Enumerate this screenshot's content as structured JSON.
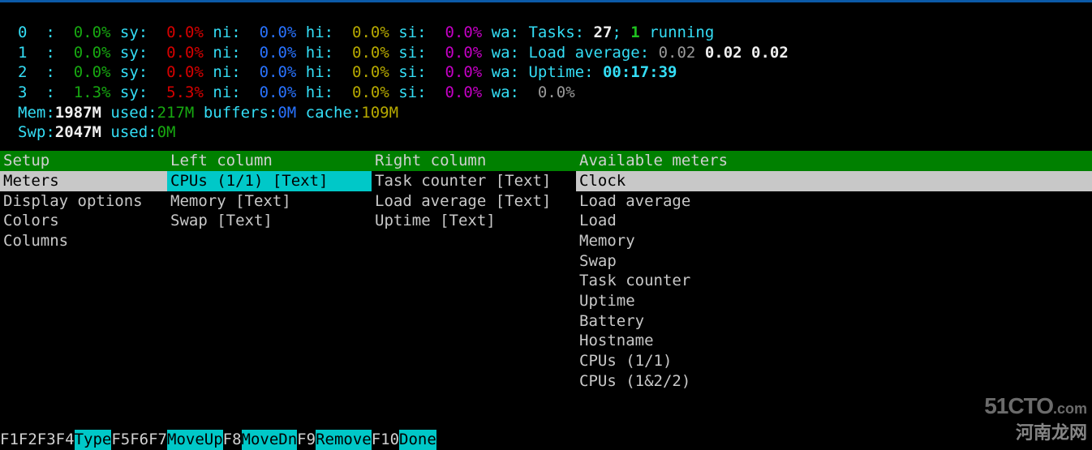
{
  "cpus": [
    {
      "id": "0",
      "us": "0.0%",
      "sy": "0.0%",
      "ni": "0.0%",
      "hi": "0.0%",
      "si": "0.0%",
      "wa": ""
    },
    {
      "id": "1",
      "us": "0.0%",
      "sy": "0.0%",
      "ni": "0.0%",
      "hi": "0.0%",
      "si": "0.0%",
      "wa": ""
    },
    {
      "id": "2",
      "us": "0.0%",
      "sy": "0.0%",
      "ni": "0.0%",
      "hi": "0.0%",
      "si": "0.0%",
      "wa": ""
    },
    {
      "id": "3",
      "us": "1.3%",
      "sy": "5.3%",
      "ni": "0.0%",
      "hi": "0.0%",
      "si": "0.0%",
      "wa": "0.0%"
    }
  ],
  "tasks": {
    "label": "Tasks: ",
    "total": "27",
    "sep": "; ",
    "running": "1",
    "suffix": " running"
  },
  "load": {
    "label": "Load average: ",
    "v1": "0.02",
    "v2": "0.02",
    "v3": "0.02"
  },
  "uptime": {
    "label": "Uptime: ",
    "value": "00:17:39"
  },
  "mem": {
    "label": "Mem:",
    "total": "1987M",
    "usedLabel": " used:",
    "used": "217M",
    "buffersLabel": " buffers:",
    "buffers": "0M",
    "cacheLabel": " cache:",
    "cache": "109M"
  },
  "swp": {
    "label": "Swp:",
    "total": "2047M",
    "usedLabel": " used:",
    "used": "0M"
  },
  "panels": {
    "setup": {
      "title": "Setup",
      "items": [
        "Meters",
        "Display options",
        "Colors",
        "Columns"
      ],
      "highlightGrey": 0
    },
    "left": {
      "title": "Left column",
      "items": [
        "CPUs (1/1) [Text]",
        "Memory [Text]",
        "Swap [Text]"
      ],
      "highlightCyan": 0
    },
    "right": {
      "title": "Right column",
      "items": [
        "Task counter [Text]",
        "Load average [Text]",
        "Uptime [Text]"
      ]
    },
    "avail": {
      "title": "Available meters",
      "items": [
        "Clock",
        "Load average",
        "Load",
        "Memory",
        "Swap",
        "Task counter",
        "Uptime",
        "Battery",
        "Hostname",
        "CPUs (1/1)",
        "CPUs (1&2/2)"
      ],
      "highlightGrey": 0
    }
  },
  "footer": [
    {
      "key": "F1",
      "label": "      "
    },
    {
      "key": "F2",
      "label": "      "
    },
    {
      "key": "F3",
      "label": "      "
    },
    {
      "key": "F4",
      "label": "Type  "
    },
    {
      "key": "F5",
      "label": "      "
    },
    {
      "key": "F6",
      "label": "      "
    },
    {
      "key": "F7",
      "label": "MoveUp"
    },
    {
      "key": "F8",
      "label": "MoveDn"
    },
    {
      "key": "F9",
      "label": "Remove"
    },
    {
      "key": "F10",
      "label": "Done  "
    }
  ],
  "watermarks": {
    "w1a": "51CTO",
    "w1b": ".com",
    "w2a": "河南龙网",
    "w2b": ""
  }
}
